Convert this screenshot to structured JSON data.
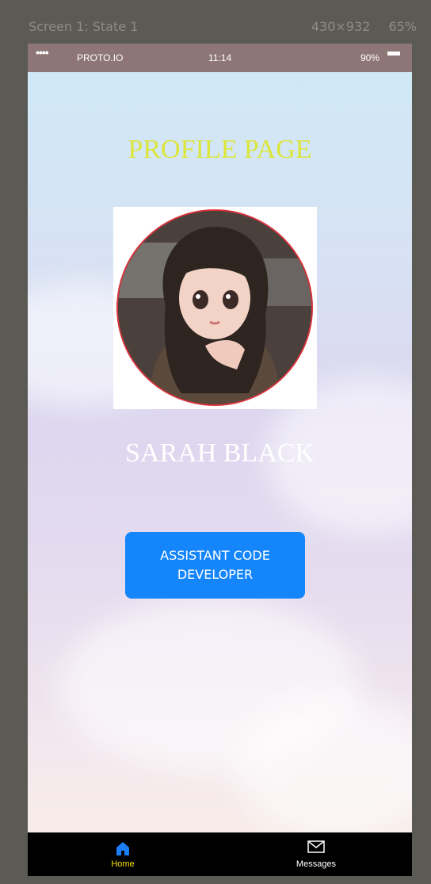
{
  "frame": {
    "title": "Screen 1: State 1",
    "resolution": "430×932",
    "zoom": "65%"
  },
  "statusbar": {
    "signal": "••••",
    "carrier": "PROTO.IO",
    "time": "11:14",
    "battery": "90%"
  },
  "page": {
    "title": "PROFILE PAGE",
    "name": "SARAH BLACK",
    "role_button": "ASSISTANT CODE DEVELOPER"
  },
  "tabbar": {
    "items": [
      {
        "label": "Home",
        "icon": "home-icon",
        "active": true
      },
      {
        "label": "Messages",
        "icon": "mail-icon",
        "active": false
      }
    ]
  },
  "colors": {
    "title": "#dce63a",
    "button": "#1485fb",
    "statusbar": "#8e7677",
    "tab_active": "#f5e400",
    "avatar_ring": "#d9343c"
  }
}
